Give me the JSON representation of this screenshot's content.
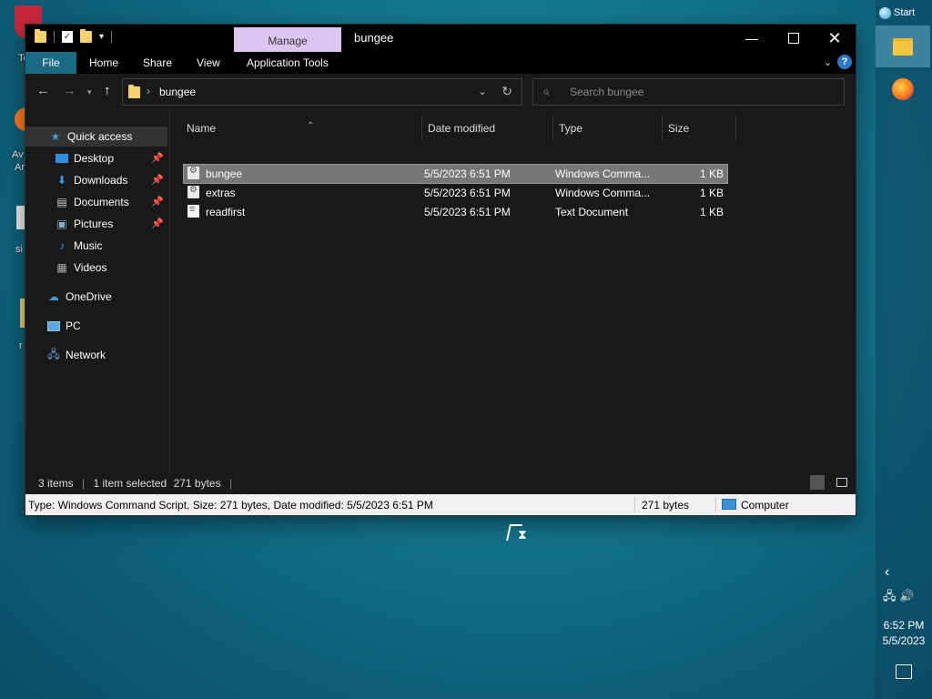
{
  "desktop": {
    "icon_labels": [
      "To",
      "Av",
      "Ar",
      "si",
      "r"
    ]
  },
  "taskbar": {
    "start_label": "Start",
    "clock_time": "6:52 PM",
    "clock_date": "5/5/2023"
  },
  "window": {
    "title": "bungee",
    "context_tab": "Manage",
    "ribbon_tabs": [
      "File",
      "Home",
      "Share",
      "View",
      "Application Tools"
    ],
    "help_label": "?",
    "address_path": "bungee",
    "search_placeholder": "Search bungee",
    "nav": [
      {
        "label": "Quick access",
        "icon": "star-icon",
        "pinned": false
      },
      {
        "label": "Desktop",
        "icon": "desktop-icon",
        "pinned": true
      },
      {
        "label": "Downloads",
        "icon": "download-icon",
        "pinned": true
      },
      {
        "label": "Documents",
        "icon": "document-icon",
        "pinned": true
      },
      {
        "label": "Pictures",
        "icon": "pictures-icon",
        "pinned": true
      },
      {
        "label": "Music",
        "icon": "music-icon",
        "pinned": false
      },
      {
        "label": "Videos",
        "icon": "videos-icon",
        "pinned": false
      },
      {
        "label": "OneDrive",
        "icon": "cloud-icon",
        "pinned": false
      },
      {
        "label": "PC",
        "icon": "computer-icon",
        "pinned": false
      },
      {
        "label": "Network",
        "icon": "network-icon",
        "pinned": false
      }
    ],
    "columns": [
      "Name",
      "Date modified",
      "Type",
      "Size"
    ],
    "files": [
      {
        "name": "bungee",
        "date": "5/5/2023 6:51 PM",
        "type": "Windows Comma...",
        "size": "1 KB",
        "icon": "cmd-script-icon",
        "selected": true
      },
      {
        "name": "extras",
        "date": "5/5/2023 6:51 PM",
        "type": "Windows Comma...",
        "size": "1 KB",
        "icon": "cmd-script-icon",
        "selected": false
      },
      {
        "name": "readfirst",
        "date": "5/5/2023 6:51 PM",
        "type": "Text Document",
        "size": "1 KB",
        "icon": "text-file-icon",
        "selected": false
      }
    ],
    "status": {
      "items": "3 items",
      "selected": "1 item selected",
      "selected_size": "271 bytes"
    },
    "infobar": {
      "details": "Type: Windows Command Script, Size: 271 bytes, Date modified: 5/5/2023 6:51 PM",
      "size": "271 bytes",
      "location": "Computer"
    }
  },
  "colors": {
    "accent_file_tab": "#1b6a83",
    "manage_tab": "#ddc5f2",
    "selection": "#777777",
    "window_bg": "#191919"
  }
}
